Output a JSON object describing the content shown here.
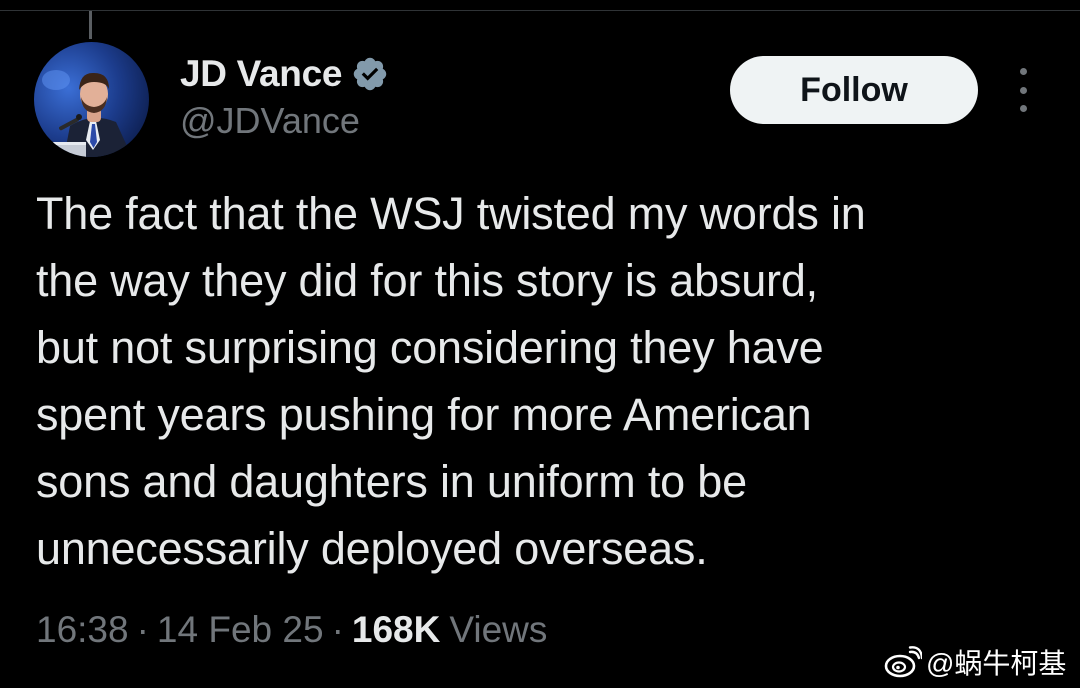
{
  "author": {
    "display_name": "JD Vance",
    "handle": "@JDVance",
    "verified": true,
    "avatar_icon": "profile-photo-avatar",
    "verified_icon": "verified-badge-icon"
  },
  "actions": {
    "follow_label": "Follow",
    "more_icon": "more-options-icon"
  },
  "tweet": {
    "lines": [
      "The fact that the WSJ twisted my words in",
      "the way they did for this story is absurd,",
      "but not surprising considering they have",
      "spent years pushing for more American",
      "sons and daughters in uniform to be",
      "unnecessarily deployed overseas."
    ]
  },
  "meta": {
    "time": "16:38",
    "separator": "·",
    "date": "14 Feb 25",
    "views_count": "168K",
    "views_label": "Views"
  },
  "watermark": {
    "text": "@蜗牛柯基",
    "icon": "weibo-icon"
  },
  "colors": {
    "background": "#000000",
    "primary_text": "#e7e9ea",
    "secondary_text": "#71767b",
    "follow_button_bg": "#eff3f4",
    "follow_button_text": "#0f1419",
    "verified_badge": "#829aab"
  }
}
